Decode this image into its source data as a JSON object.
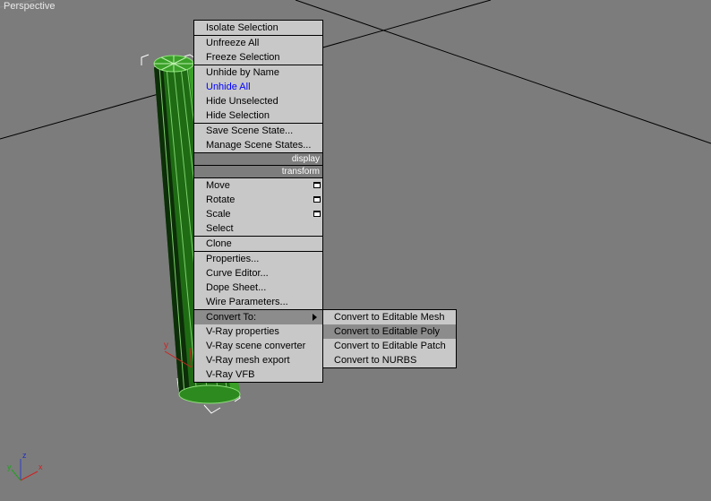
{
  "viewport": {
    "label": "Perspective"
  },
  "gizmo_axes": {
    "x": "x",
    "y": "y",
    "z": "z"
  },
  "object_axis": {
    "y": "y"
  },
  "quad_menu": {
    "items": [
      {
        "label": "Isolate Selection"
      },
      {
        "label": "Unfreeze All"
      },
      {
        "label": "Freeze Selection"
      },
      {
        "label": "Unhide by Name"
      },
      {
        "label": "Unhide All"
      },
      {
        "label": "Hide Unselected"
      },
      {
        "label": "Hide Selection"
      },
      {
        "label": "Save Scene State..."
      },
      {
        "label": "Manage Scene States..."
      }
    ],
    "headers": {
      "display": "display",
      "transform": "transform"
    },
    "transform_items": [
      {
        "label": "Move"
      },
      {
        "label": "Rotate"
      },
      {
        "label": "Scale"
      },
      {
        "label": "Select"
      },
      {
        "label": "Clone"
      },
      {
        "label": "Properties..."
      },
      {
        "label": "Curve Editor..."
      },
      {
        "label": "Dope Sheet..."
      },
      {
        "label": "Wire Parameters..."
      },
      {
        "label": "Convert To:"
      },
      {
        "label": "V-Ray properties"
      },
      {
        "label": "V-Ray scene converter"
      },
      {
        "label": "V-Ray mesh export"
      },
      {
        "label": "V-Ray VFB"
      }
    ]
  },
  "submenu": {
    "items": [
      {
        "label": "Convert to Editable Mesh"
      },
      {
        "label": "Convert to Editable Poly"
      },
      {
        "label": "Convert to Editable Patch"
      },
      {
        "label": "Convert to NURBS"
      }
    ]
  },
  "colors": {
    "viewport_bg": "#7c7c7c",
    "menu_bg": "#c8c8c8",
    "highlight": "#8c8c8c",
    "object_green": "#2d8a1f"
  }
}
